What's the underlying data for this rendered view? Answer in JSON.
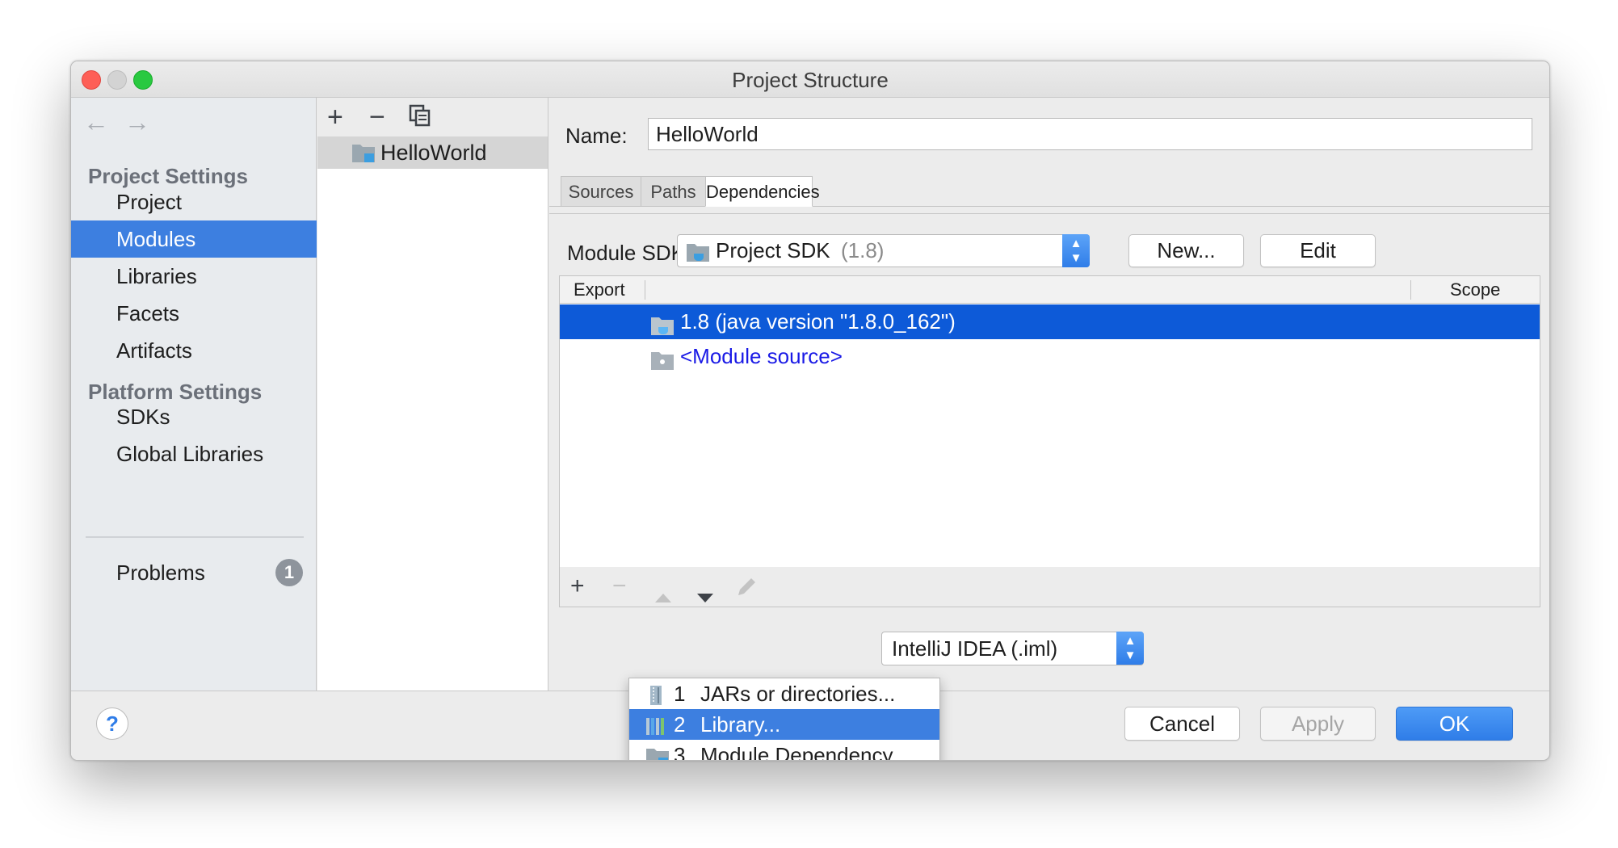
{
  "window": {
    "title": "Project Structure",
    "traffic_lights": {
      "close": "#fe5f57",
      "minimize": "#d3d3d3",
      "maximize": "#29c940"
    }
  },
  "sidebar": {
    "back_icon": "←",
    "forward_icon": "→",
    "project_settings_header": "Project Settings",
    "project_settings_items": [
      "Project",
      "Modules",
      "Libraries",
      "Facets",
      "Artifacts"
    ],
    "platform_settings_header": "Platform Settings",
    "platform_settings_items": [
      "SDKs",
      "Global Libraries"
    ],
    "problems_label": "Problems",
    "problems_count": "1",
    "selected_item": "Modules"
  },
  "modules_panel": {
    "add_icon": "+",
    "remove_icon": "−",
    "copy_icon": "copy-icon",
    "modules": [
      "HelloWorld"
    ]
  },
  "module": {
    "name_label": "Name:",
    "name_value": "HelloWorld",
    "tabs": [
      "Sources",
      "Paths",
      "Dependencies"
    ],
    "active_tab": "Dependencies",
    "sdk_label": "Module SDK:",
    "sdk_value": "Project SDK",
    "sdk_version": "(1.8)",
    "new_button": "New...",
    "edit_button": "Edit",
    "table": {
      "col_export": "Export",
      "col_scope": "Scope",
      "rows": [
        {
          "label": "1.8 (java version \"1.8.0_162\")",
          "selected": true
        },
        {
          "label": "<Module source>",
          "selected": false
        }
      ]
    },
    "format_value": "IntelliJ IDEA (.iml)"
  },
  "add_popup": {
    "items": [
      {
        "num": "1",
        "label": "JARs or directories..."
      },
      {
        "num": "2",
        "label": "Library..."
      },
      {
        "num": "3",
        "label": "Module Dependency..."
      }
    ],
    "selected_index": 1
  },
  "footer": {
    "help_label": "?",
    "cancel_button": "Cancel",
    "apply_button": "Apply",
    "ok_button": "OK"
  },
  "colors": {
    "selection": "#3d7fe0",
    "table_selection": "#0d5ad8",
    "link": "#1a1ae6",
    "primary_button": "#2f84ee"
  }
}
